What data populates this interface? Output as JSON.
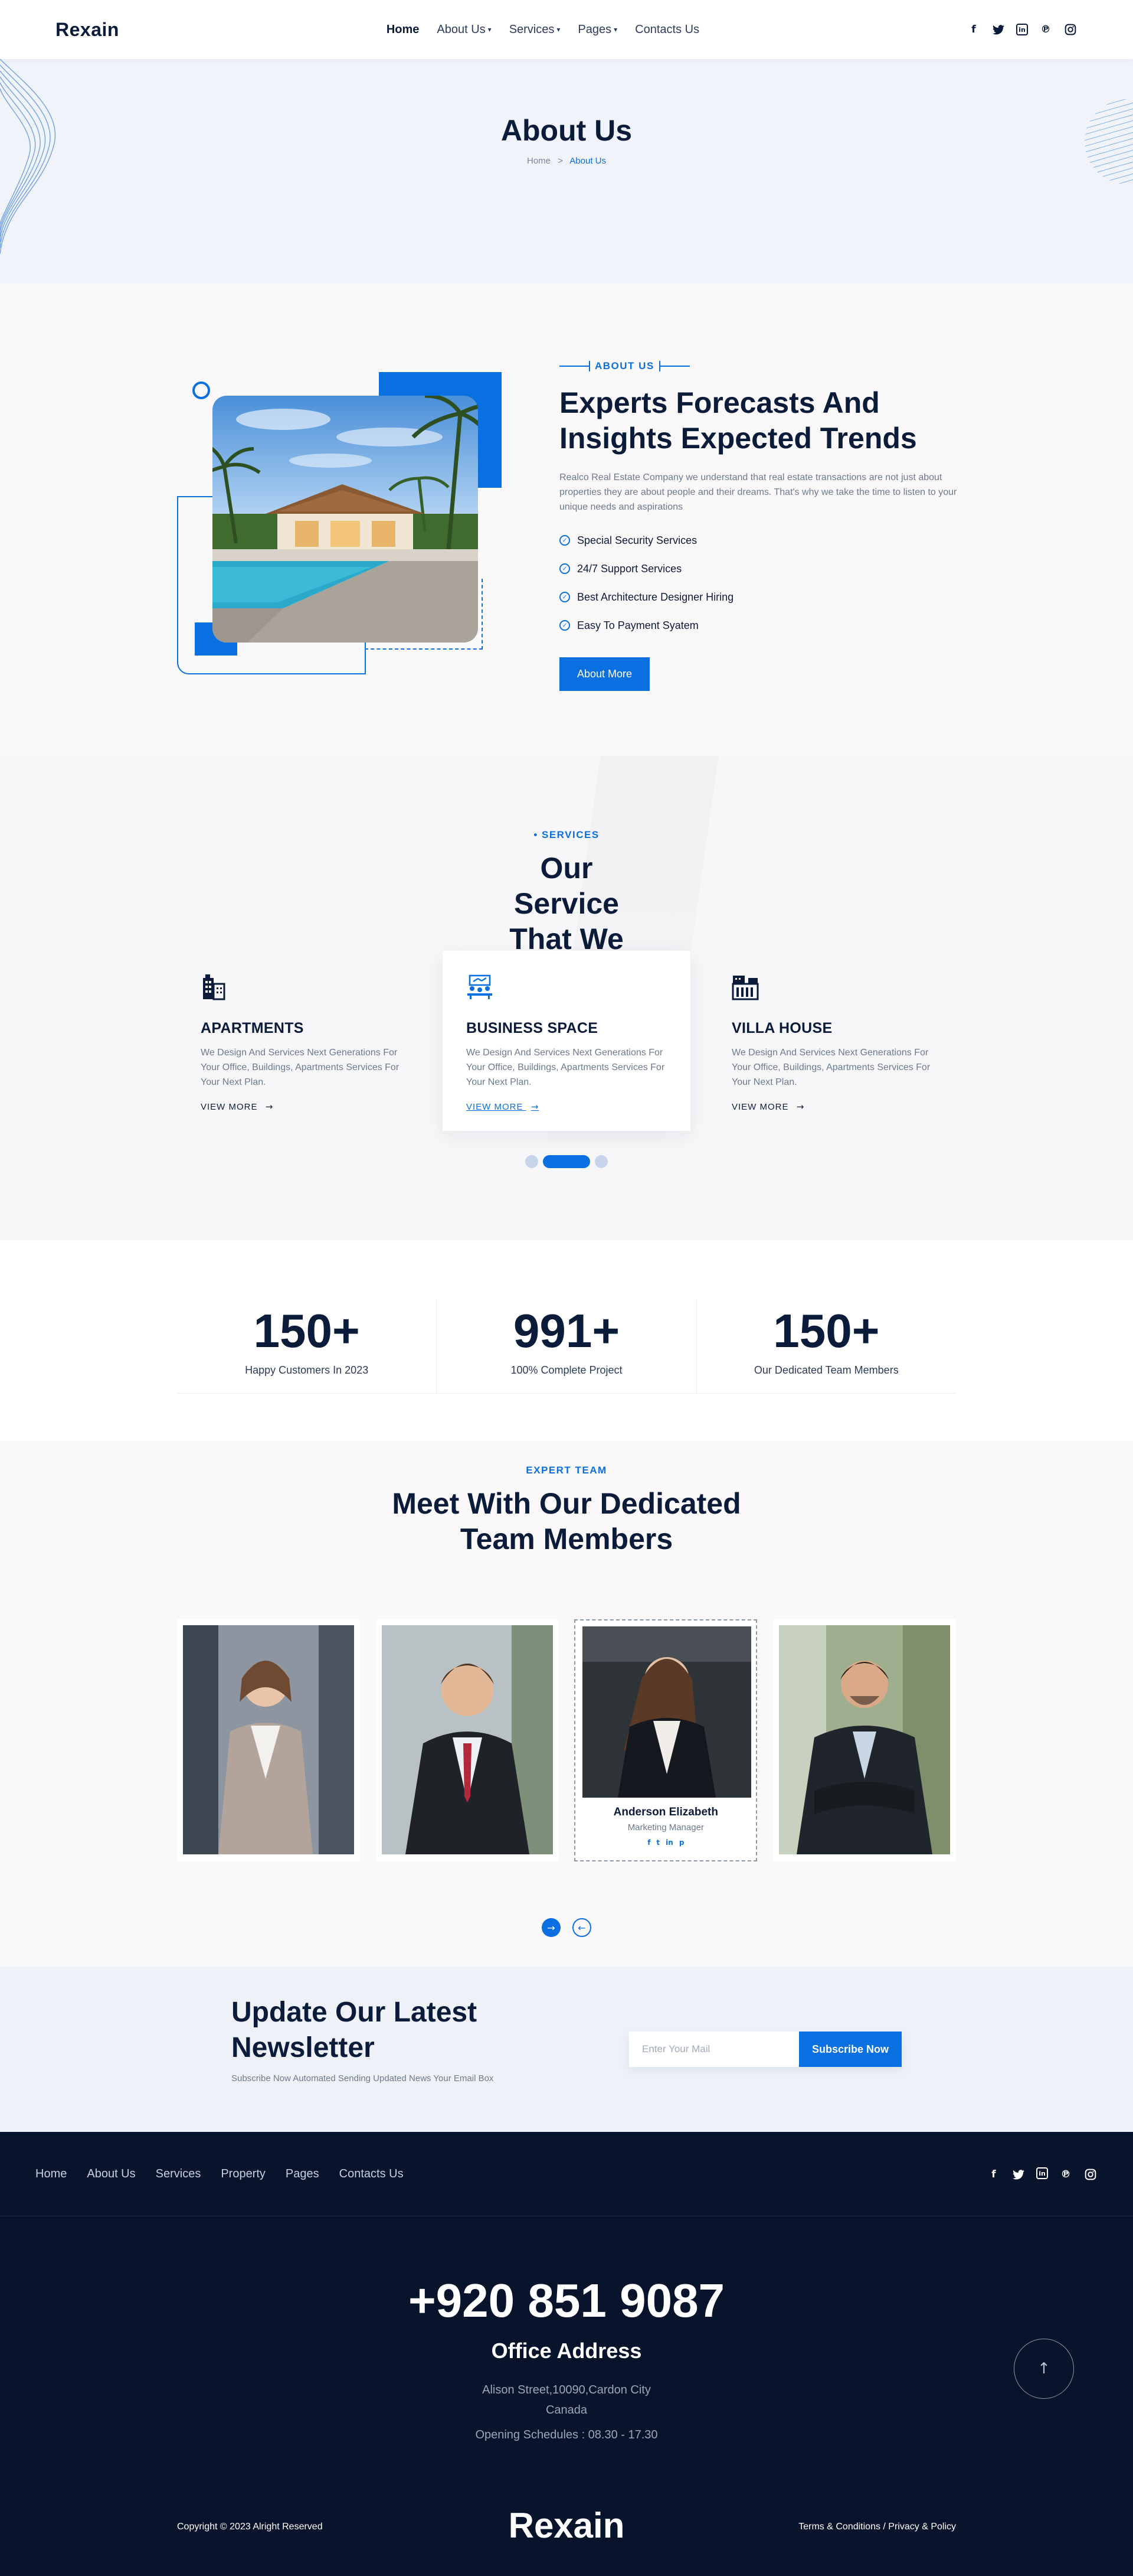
{
  "header": {
    "logo": "Rexain",
    "nav": [
      {
        "label": "Home",
        "active": true,
        "dropdown": false
      },
      {
        "label": "About Us",
        "active": false,
        "dropdown": true
      },
      {
        "label": "Services",
        "active": false,
        "dropdown": true
      },
      {
        "label": "Pages",
        "active": false,
        "dropdown": true
      },
      {
        "label": "Contacts Us",
        "active": false,
        "dropdown": false
      }
    ],
    "socials": [
      "facebook-icon",
      "twitter-icon",
      "linkedin-icon",
      "pinterest-icon",
      "instagram-icon"
    ]
  },
  "banner": {
    "title": "About Us",
    "breadcrumb_home": "Home",
    "breadcrumb_sep": ">",
    "breadcrumb_current": "About Us"
  },
  "about": {
    "eyebrow": "ABOUT US",
    "heading": "Experts Forecasts And Insights Expected Trends",
    "description": "Realco Real Estate Company we understand that real estate transactions are not just about properties they are about people and their dreams. That's why we take the time to listen to your unique needs and aspirations",
    "features": [
      "Special Security Services",
      "24/7 Support Services",
      "Best Architecture Designer Hiring",
      "Easy To Payment Syatem"
    ],
    "button": "About More"
  },
  "services": {
    "eyebrow": "SERVICES",
    "heading": "Our Service That We Provide",
    "cards": [
      {
        "title": "APARTMENTS",
        "text": "We Design And Services Next Generations For Your Office, Buildings, Apartments Services For Your Next Plan.",
        "link": "VIEW MORE",
        "icon": "building-icon",
        "active": false
      },
      {
        "title": "BUSINESS SPACE",
        "text": "We Design And Services Next Generations For Your Office, Buildings, Apartments Services For Your Next Plan.",
        "link": "VIEW MORE",
        "icon": "meeting-icon",
        "active": true
      },
      {
        "title": "VILLA HOUSE",
        "text": "We Design And Services Next Generations For Your Office, Buildings, Apartments Services For Your Next Plan.",
        "link": "VIEW MORE",
        "icon": "villa-icon",
        "active": false
      }
    ]
  },
  "stats": [
    {
      "value": "150+",
      "label": "Happy Customers In 2023"
    },
    {
      "value": "991+",
      "label": "100% Complete Project"
    },
    {
      "value": "150+",
      "label": "Our Dedicated Team Members"
    }
  ],
  "team": {
    "eyebrow": "EXPERT TEAM",
    "heading": "Meet With Our Dedicated Team Members",
    "active_member": {
      "name": "Anderson Elizabeth",
      "role": "Marketing Manager"
    }
  },
  "newsletter": {
    "heading": "Update Our Latest Newsletter",
    "text": "Subscribe Now Automated Sending Updated News Your Email Box",
    "placeholder": "Enter Your Mail",
    "button": "Subscribe Now"
  },
  "footer": {
    "nav": [
      "Home",
      "About Us",
      "Services",
      "Property",
      "Pages",
      "Contacts Us"
    ],
    "phone": "+920 851 9087",
    "office_title": "Office Address",
    "address_line1": "Alison Street,10090,Cardon City",
    "address_line2": "Canada",
    "hours": "Opening Schedules : 08.30 - 17.30",
    "copyright": "Copyright © 2023 Alright Reserved",
    "logo": "Rexain",
    "terms": "Terms & Conditions / Privacy & Policy"
  },
  "colors": {
    "accent": "#0a6fe0",
    "dark": "#0b1b3a",
    "footer_bg": "#07142b"
  }
}
